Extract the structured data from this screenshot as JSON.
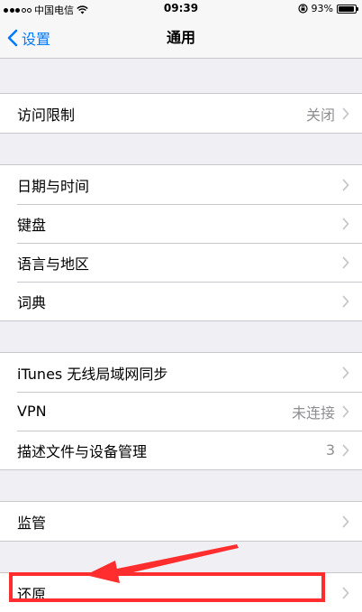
{
  "status_bar": {
    "carrier": "中国电信",
    "time": "09:39",
    "battery_percent_label": "93%",
    "battery_level": 0.93
  },
  "nav": {
    "back_label": "设置",
    "title": "通用"
  },
  "groups": [
    {
      "cells": [
        {
          "label": "访问限制",
          "value": "关闭"
        }
      ]
    },
    {
      "cells": [
        {
          "label": "日期与时间",
          "value": ""
        },
        {
          "label": "键盘",
          "value": ""
        },
        {
          "label": "语言与地区",
          "value": ""
        },
        {
          "label": "词典",
          "value": ""
        }
      ]
    },
    {
      "cells": [
        {
          "label": "iTunes 无线局域网同步",
          "value": ""
        },
        {
          "label": "VPN",
          "value": "未连接"
        },
        {
          "label": "描述文件与设备管理",
          "value": "3"
        }
      ]
    },
    {
      "cells": [
        {
          "label": "监管",
          "value": ""
        }
      ]
    },
    {
      "cells": [
        {
          "label": "还原",
          "value": ""
        }
      ]
    }
  ],
  "annotation": {
    "highlight_color": "#ff2d2d",
    "highlighted_item": "还原"
  },
  "colors": {
    "accent": "#007aff",
    "background": "#efeff4",
    "separator": "#c8c7cc",
    "secondary_text": "#8e8e93"
  }
}
